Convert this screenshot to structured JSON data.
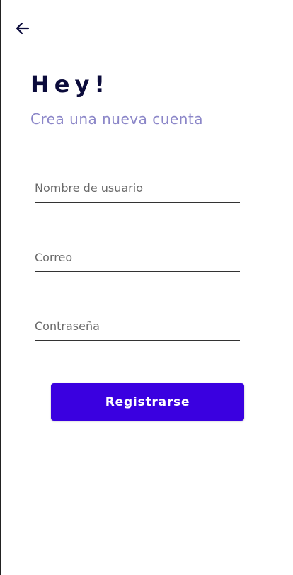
{
  "header": {
    "back_icon": "arrow-left-icon"
  },
  "title": "Hey!",
  "subtitle": "Crea una nueva cuenta",
  "form": {
    "username_placeholder": "Nombre de usuario",
    "email_placeholder": "Correo",
    "password_placeholder": "Contraseña",
    "submit_label": "Registrarse"
  },
  "colors": {
    "title": "#0b0b3b",
    "subtitle": "#8b86c8",
    "button": "#3a00e0"
  }
}
